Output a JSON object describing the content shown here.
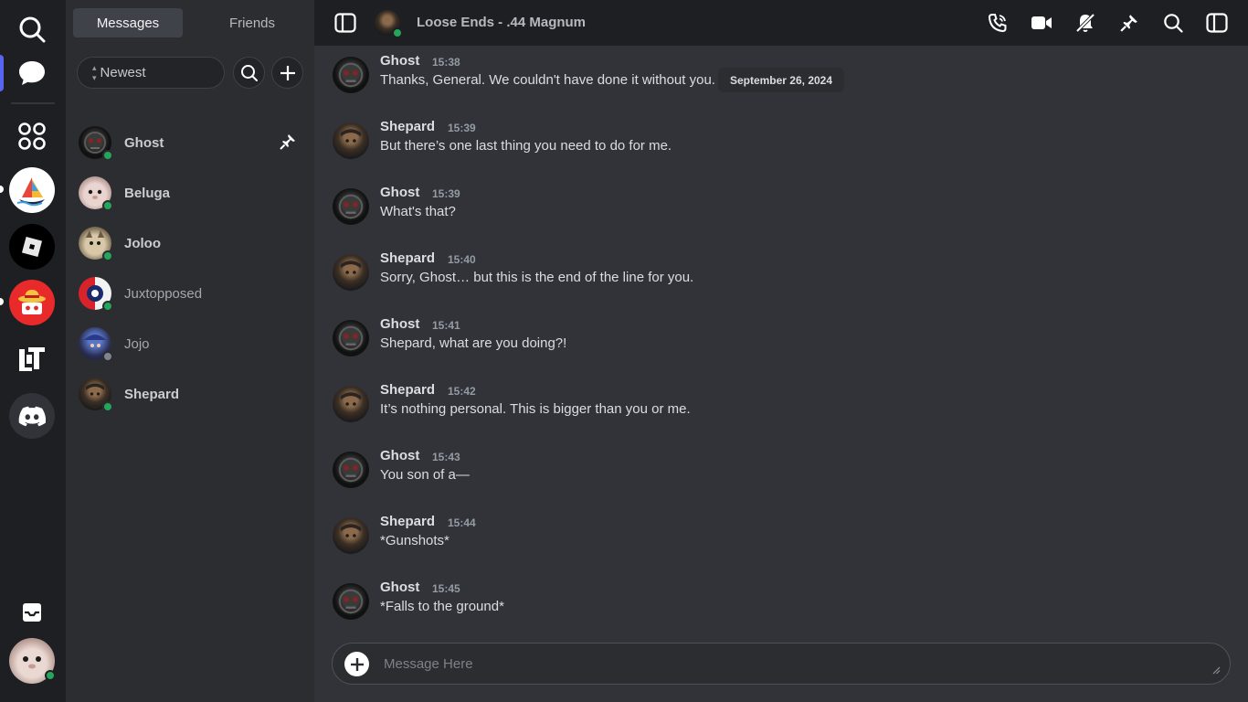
{
  "rail": {
    "items": [
      {
        "name": "search",
        "icon": "search-icon"
      },
      {
        "name": "direct-messages",
        "icon": "chat-bubble-icon",
        "active": true
      },
      {
        "name": "discover",
        "icon": "apps-grid-icon"
      },
      {
        "name": "server-sailboat",
        "icon": "sailboat-icon"
      },
      {
        "name": "server-roblox",
        "icon": "roblox-icon"
      },
      {
        "name": "server-strawhat",
        "icon": "strawhat-icon"
      },
      {
        "name": "server-lt",
        "icon": "lt-logo-icon"
      },
      {
        "name": "server-discord",
        "icon": "discord-icon"
      }
    ],
    "inbox_icon": "inbox-icon",
    "user_status_color": "#23a55a"
  },
  "sidebar": {
    "tabs": [
      {
        "label": "Messages",
        "active": true
      },
      {
        "label": "Friends",
        "active": false
      }
    ],
    "sort_label": "Newest",
    "dms": [
      {
        "name": "Ghost",
        "status": "online",
        "bold": true,
        "pinned": true
      },
      {
        "name": "Beluga",
        "status": "online",
        "bold": true
      },
      {
        "name": "Joloo",
        "status": "online",
        "bold": true
      },
      {
        "name": "Juxtopposed",
        "status": "online",
        "bold": false
      },
      {
        "name": "Jojo",
        "status": "offline",
        "bold": false
      },
      {
        "name": "Shepard",
        "status": "online",
        "bold": true
      }
    ]
  },
  "header": {
    "title": "Loose Ends - .44 Magnum",
    "icons": [
      "phone-icon",
      "video-icon",
      "mute-notifications-icon",
      "pin-icon",
      "search-icon",
      "panel-toggle-icon"
    ]
  },
  "chat": {
    "date_divider": "September 26, 2024",
    "messages": [
      {
        "author": "Ghost",
        "time": "15:38",
        "text": "Thanks, General. We couldn't have done it without you."
      },
      {
        "author": "Shepard",
        "time": "15:39",
        "text": "But there’s one last thing you need to do for me."
      },
      {
        "author": "Ghost",
        "time": "15:39",
        "text": "What's that?"
      },
      {
        "author": "Shepard",
        "time": "15:40",
        "text": "Sorry, Ghost… but this is the end of the line for you."
      },
      {
        "author": "Ghost",
        "time": "15:41",
        "text": "Shepard, what are you doing?!"
      },
      {
        "author": "Shepard",
        "time": "15:42",
        "text": "It’s nothing personal. This is bigger than you or me."
      },
      {
        "author": "Ghost",
        "time": "15:43",
        "text": "You son of a—"
      },
      {
        "author": "Shepard",
        "time": "15:44",
        "text": "*Gunshots*"
      },
      {
        "author": "Ghost",
        "time": "15:45",
        "text": "*Falls to the ground*"
      }
    ]
  },
  "composer": {
    "placeholder": "Message Here",
    "value": ""
  },
  "colors": {
    "online": "#23a55a",
    "offline": "#80848e",
    "accent": "#5865f2"
  }
}
